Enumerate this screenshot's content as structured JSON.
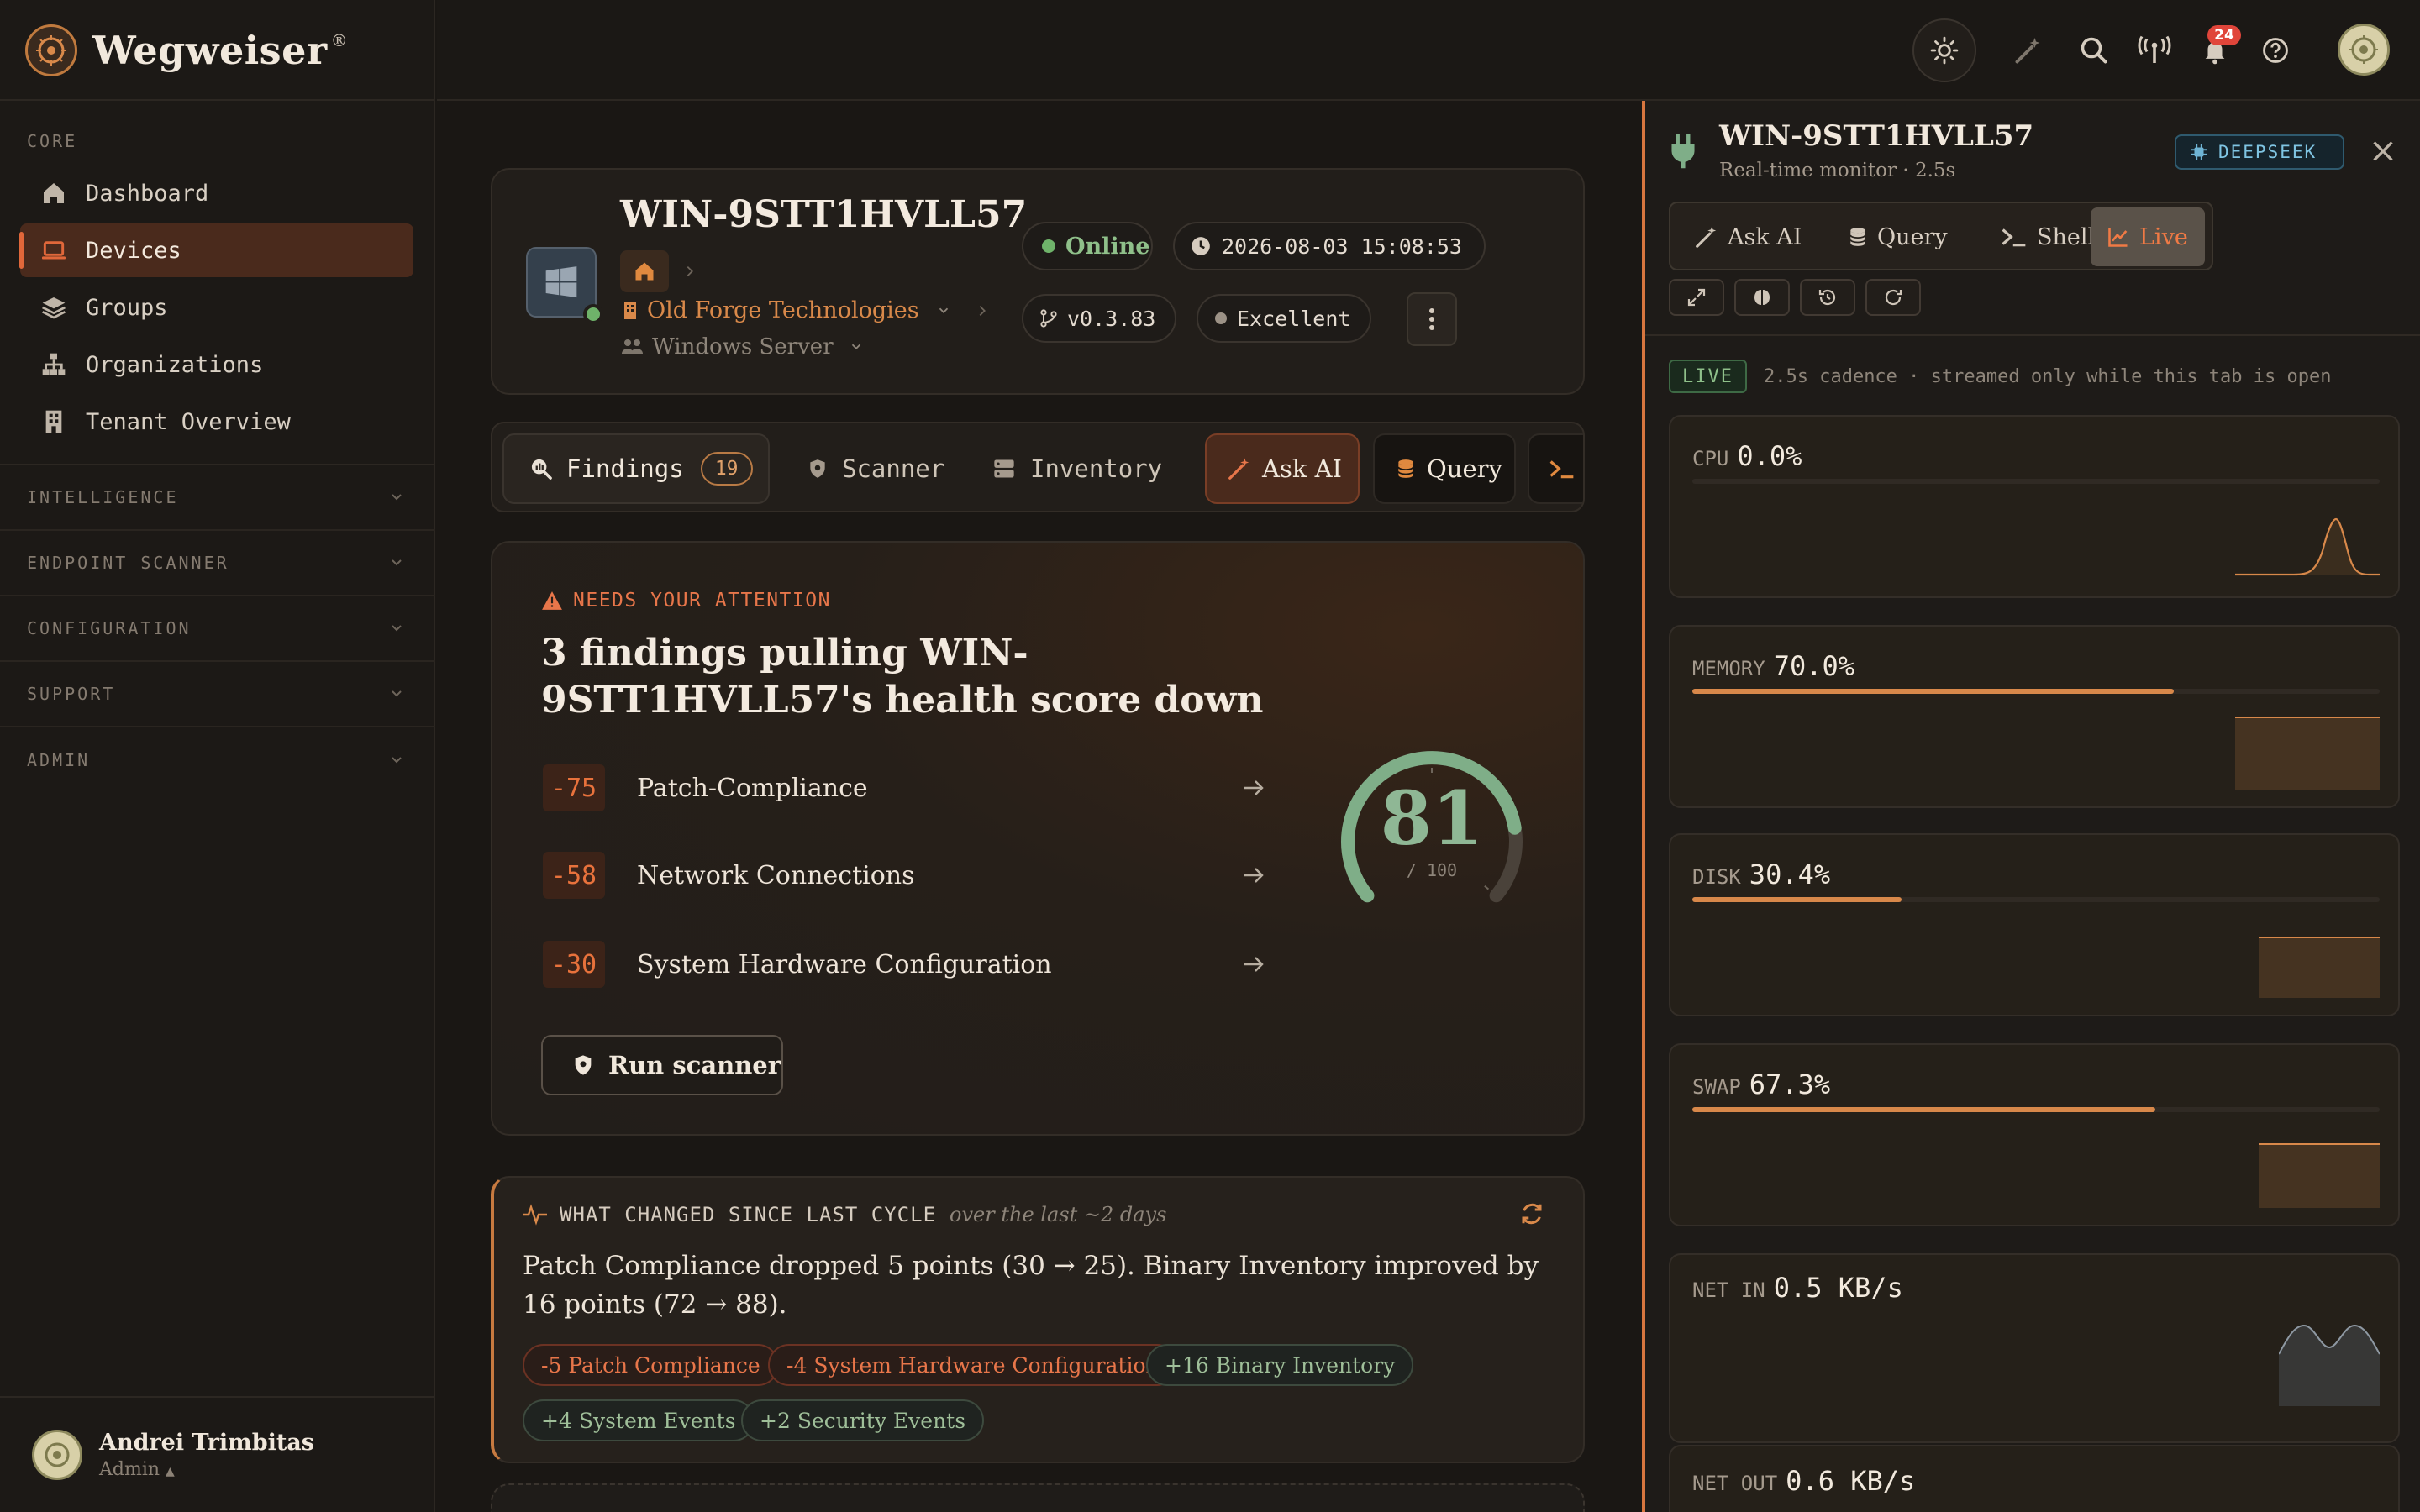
{
  "app": {
    "name": "Wegweiser",
    "reg": "®"
  },
  "sidebar": {
    "core_label": "CORE",
    "items": [
      {
        "label": "Dashboard",
        "icon": "home-icon"
      },
      {
        "label": "Devices",
        "icon": "laptop-icon",
        "active": true
      },
      {
        "label": "Groups",
        "icon": "layers-icon"
      },
      {
        "label": "Organizations",
        "icon": "org-chart-icon"
      },
      {
        "label": "Tenant Overview",
        "icon": "building-icon"
      }
    ],
    "groups": [
      "INTELLIGENCE",
      "ENDPOINT SCANNER",
      "CONFIGURATION",
      "SUPPORT",
      "ADMIN"
    ],
    "user": {
      "name": "Andrei Trimbitas",
      "role": "Admin"
    }
  },
  "topbar": {
    "notifications_count": "24"
  },
  "device": {
    "name": "WIN-9STT1HVLL57",
    "organization": "Old Forge Technologies",
    "group": "Windows Server",
    "status": "Online",
    "last_seen": "2026-08-03 15:08:53",
    "version": "v0.3.83",
    "health_label": "Excellent",
    "status_color": "#6fb36a"
  },
  "tabs": [
    {
      "label": "Findings",
      "count": "19"
    },
    {
      "label": "Scanner"
    },
    {
      "label": "Inventory"
    },
    {
      "label": "Ask AI"
    },
    {
      "label": "Query"
    }
  ],
  "attention": {
    "kicker": "NEEDS YOUR ATTENTION",
    "headline": "3 findings pulling WIN-9STT1HVLL57's health score down",
    "findings": [
      {
        "score": "-75",
        "name": "Patch-Compliance"
      },
      {
        "score": "-58",
        "name": "Network Connections"
      },
      {
        "score": "-30",
        "name": "System Hardware Configuration"
      }
    ],
    "run_button": "Run scanner",
    "health_score": 81,
    "health_max_label": "/ 100",
    "health_max": 100,
    "accent_color": "#e0673a",
    "gauge_color": "#7fae88"
  },
  "changes": {
    "title": "WHAT CHANGED SINCE LAST CYCLE",
    "subtitle": "over the last ~2 days",
    "summary": "Patch Compliance dropped 5 points (30 → 25). Binary Inventory improved by 16 points (72 → 88).",
    "chips": [
      {
        "delta": "-5",
        "label": "Patch Compliance",
        "kind": "neg"
      },
      {
        "delta": "-4",
        "label": "System Hardware Configuration",
        "kind": "neg"
      },
      {
        "delta": "+16",
        "label": "Binary Inventory",
        "kind": "pos"
      },
      {
        "delta": "+4",
        "label": "System Events",
        "kind": "pos"
      },
      {
        "delta": "+2",
        "label": "Security Events",
        "kind": "pos"
      }
    ]
  },
  "panel": {
    "title": "WIN-9STT1HVLL57",
    "subtitle": "Real-time monitor · 2.5s",
    "model_badge": "DEEPSEEK",
    "tabs": [
      "Ask AI",
      "Query",
      "Shell",
      "Live"
    ],
    "active_tab": "Live",
    "live_badge": "LIVE",
    "live_note": "2.5s cadence · streamed only while this tab is open",
    "metrics": [
      {
        "label": "CPU",
        "value": "0.0%",
        "level": 0.0
      },
      {
        "label": "MEMORY",
        "value": "70.0%",
        "level": 0.7
      },
      {
        "label": "DISK",
        "value": "30.4%",
        "level": 0.304
      },
      {
        "label": "SWAP",
        "value": "67.3%",
        "level": 0.673
      },
      {
        "label": "NET IN",
        "value": "0.5 KB/s"
      },
      {
        "label": "NET OUT",
        "value": "0.6 KB/s"
      }
    ]
  }
}
